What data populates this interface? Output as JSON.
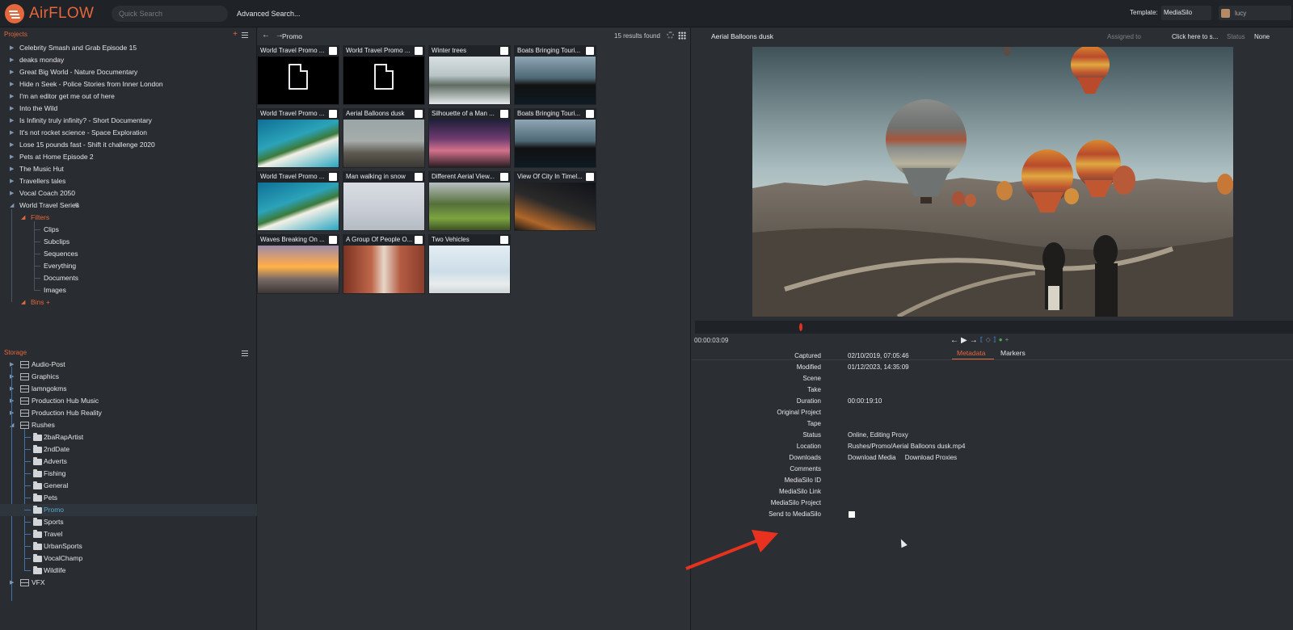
{
  "app": {
    "name": "AirFLOW"
  },
  "header": {
    "search_placeholder": "Quick Search",
    "advanced_search": "Advanced Search...",
    "template_label": "Template:",
    "template_value": "MediaSilo",
    "user": "lucy"
  },
  "projects": {
    "title": "Projects",
    "add": "+",
    "items": [
      "Celebrity Smash and Grab Episode 15",
      "deaks monday",
      "Great Big World - Nature Documentary",
      "Hide n Seek - Police Stories from Inner London",
      "I'm an editor get me out of here",
      "Into the Wild",
      "Is Infinity truly infinity? - Short Documentary",
      "It's not rocket science - Space Exploration",
      "Lose 15 pounds fast - Shift it challenge 2020",
      "Pets at Home Episode 2",
      "The Music Hut",
      "Travellers tales",
      "Vocal Coach 2050",
      "World Travel Series"
    ],
    "filters_label": "Filters",
    "filters": [
      "Clips",
      "Subclips",
      "Sequences",
      "Everything",
      "Documents",
      "Images"
    ],
    "bins_label": "Bins",
    "bins_add": "+"
  },
  "storage": {
    "title": "Storage",
    "drives": [
      "Audio-Post",
      "Graphics",
      "lamngokms",
      "Production Hub Music",
      "Production Hub Reality",
      "Rushes"
    ],
    "rushes_folders": [
      "2baRapArtist",
      "2ndDate",
      "Adverts",
      "Fishing",
      "General",
      "Pets",
      "Promo",
      "Sports",
      "Travel",
      "UrbanSports",
      "VocalChamp",
      "Wildlife"
    ],
    "last_drive": "VFX",
    "selected_folder": "Promo"
  },
  "browser": {
    "back": "←",
    "forward": "→",
    "title": "Promo",
    "results": "15 results found",
    "items": [
      "World Travel Promo ...",
      "World Travel Promo ...",
      "Winter trees",
      "Boats Bringing Touri...",
      "World Travel Promo ...",
      "Aerial Balloons dusk",
      "Silhouette of a Man ...",
      "Boats Bringing Touri...",
      "World Travel Promo ...",
      "Man walking in snow",
      "Different Aerial View...",
      "View Of City In Timel...",
      "Waves Breaking On ...",
      "A Group Of People O...",
      "Two Vehicles"
    ]
  },
  "viewer": {
    "title": "Aerial Balloons dusk",
    "assigned_label": "Assigned to",
    "assigned_value": "Click here to s...",
    "status_label": "Status",
    "status_value": "None",
    "timecode": "00:00:03:09",
    "transport": [
      "←",
      "▶",
      "→",
      "⟦",
      "◇",
      "⟧",
      "●",
      "+"
    ],
    "tabs": [
      "Metadata",
      "Markers"
    ]
  },
  "metadata": {
    "rows": [
      {
        "key": "Captured",
        "value": "02/10/2019, 07:05:46"
      },
      {
        "key": "Modified",
        "value": "01/12/2023, 14:35:09"
      },
      {
        "key": "Scene",
        "value": ""
      },
      {
        "key": "Take",
        "value": ""
      },
      {
        "key": "Duration",
        "value": "00:00:19:10"
      },
      {
        "key": "Original Project",
        "value": ""
      },
      {
        "key": "Tape",
        "value": ""
      },
      {
        "key": "Status",
        "value": "Online, Editing Proxy"
      },
      {
        "key": "Location",
        "value": "Rushes/Promo/Aerial Balloons dusk.mp4"
      },
      {
        "key": "Downloads",
        "value": "Download Media     Download Proxies"
      },
      {
        "key": "Comments",
        "value": ""
      },
      {
        "key": "MediaSilo ID",
        "value": ""
      },
      {
        "key": "MediaSilo Link",
        "value": ""
      },
      {
        "key": "MediaSilo Project",
        "value": ""
      },
      {
        "key": "Send to MediaSilo",
        "value": ""
      }
    ]
  },
  "colors": {
    "accent": "#e5673d",
    "selected": "#58a9c9",
    "annotation_arrow": "#e8311f"
  }
}
